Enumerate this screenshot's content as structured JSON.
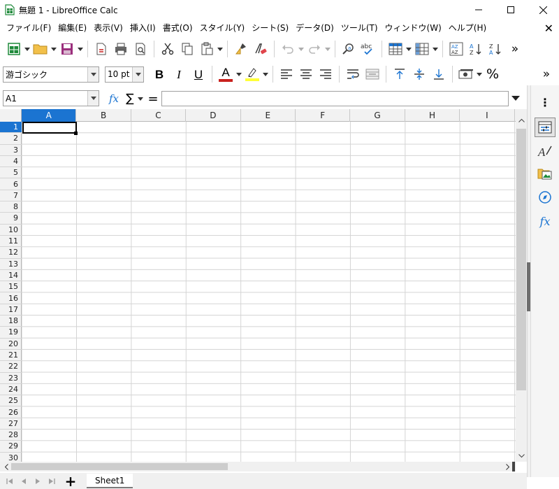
{
  "window": {
    "title": "無題 1 - LibreOffice Calc",
    "minimize_glyph": "—",
    "maximize_glyph": "☐",
    "close_glyph": "✕"
  },
  "menu": {
    "items": [
      {
        "label": "ファイル(F)"
      },
      {
        "label": "編集(E)"
      },
      {
        "label": "表示(V)"
      },
      {
        "label": "挿入(I)"
      },
      {
        "label": "書式(O)"
      },
      {
        "label": "スタイル(Y)"
      },
      {
        "label": "シート(S)"
      },
      {
        "label": "データ(D)"
      },
      {
        "label": "ツール(T)"
      },
      {
        "label": "ウィンドウ(W)"
      },
      {
        "label": "ヘルプ(H)"
      }
    ],
    "close_glyph": "✕"
  },
  "toolbar1": {
    "more_glyph": "»"
  },
  "toolbar2": {
    "font_name": "游ゴシック",
    "font_size": "10 pt",
    "bold": "B",
    "italic": "I",
    "underline": "U",
    "font_color_letter": "A",
    "percent": "%",
    "more_glyph": "»"
  },
  "formula_bar": {
    "name_box": "A1",
    "fx": "fx",
    "sum": "∑",
    "equals": "=",
    "formula_value": ""
  },
  "grid": {
    "columns": [
      "A",
      "B",
      "C",
      "D",
      "E",
      "F",
      "G",
      "H",
      "I"
    ],
    "rows": [
      "1",
      "2",
      "3",
      "4",
      "5",
      "6",
      "7",
      "8",
      "9",
      "10",
      "11",
      "12",
      "13",
      "14",
      "15",
      "16",
      "17",
      "18",
      "19",
      "20",
      "21",
      "22",
      "23",
      "24",
      "25",
      "26",
      "27",
      "28",
      "29",
      "30"
    ],
    "active_cell": "A1"
  },
  "sidebar": {
    "menu_glyph": "⋮",
    "fx": "fx"
  },
  "sheets": {
    "tabs": [
      {
        "label": "Sheet1"
      }
    ],
    "add_glyph": "+"
  },
  "colors": {
    "accent": "#1b74d1",
    "calc_green": "#1e8a3a",
    "font_color_bar": "#c9211e",
    "highlight_bar": "#ffff38"
  }
}
